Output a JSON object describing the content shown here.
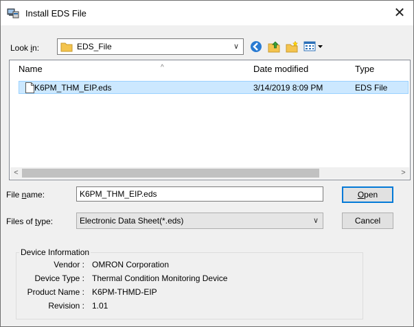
{
  "window": {
    "title": "Install EDS File"
  },
  "look_in": {
    "label_pre": "Look ",
    "label_ul": "i",
    "label_post": "n:",
    "value": "EDS_File"
  },
  "file_list": {
    "columns": [
      "Name",
      "Date modified",
      "Type"
    ],
    "rows": [
      {
        "name": "K6PM_THM_EIP.eds",
        "date": "3/14/2019 8:09 PM",
        "type": "EDS File",
        "selected": true
      }
    ]
  },
  "file_name": {
    "label_pre": "File ",
    "label_ul": "n",
    "label_post": "ame:",
    "value": "K6PM_THM_EIP.eds"
  },
  "files_of_type": {
    "label_pre": "Files of ",
    "label_ul": "t",
    "label_post": "ype:",
    "value": "Electronic Data Sheet(*.eds)"
  },
  "buttons": {
    "open_ul": "O",
    "open_rest": "pen",
    "cancel": "Cancel"
  },
  "device_info": {
    "title": "Device Information",
    "vendor_label": "Vendor :",
    "vendor": "OMRON Corporation",
    "device_type_label": "Device Type :",
    "device_type": "Thermal Condition Monitoring Device",
    "product_name_label": "Product Name :",
    "product_name": "K6PM-THMD-EIP",
    "revision_label": "Revision :",
    "revision": "1.01"
  },
  "colors": {
    "selection": "#cce8ff",
    "accent": "#0078d7",
    "folder": "#f4c44e"
  }
}
